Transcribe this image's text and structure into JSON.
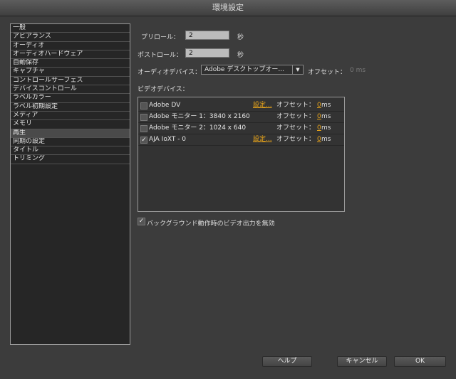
{
  "window": {
    "title": "環境設定"
  },
  "sidebar": {
    "items": [
      {
        "label": "一般"
      },
      {
        "label": "アピアランス"
      },
      {
        "label": "オーディオ"
      },
      {
        "label": "オーディオハードウェア"
      },
      {
        "label": "自動保存"
      },
      {
        "label": "キャプチャ"
      },
      {
        "label": "コントロールサーフェス"
      },
      {
        "label": "デバイスコントロール"
      },
      {
        "label": "ラベルカラー"
      },
      {
        "label": "ラベル初期設定"
      },
      {
        "label": "メディア"
      },
      {
        "label": "メモリ"
      },
      {
        "label": "再生"
      },
      {
        "label": "同期の設定"
      },
      {
        "label": "タイトル"
      },
      {
        "label": "トリミング"
      }
    ],
    "selected": "再生"
  },
  "playback": {
    "preroll_label": "プリロール：",
    "preroll_value": "2",
    "postroll_label": "ポストロール：",
    "postroll_value": "2",
    "seconds_unit": "秒",
    "audio_device_label": "オーディオデバイス：",
    "audio_device_value": "Adobe デスクトップオー...",
    "audio_offset_label": "オフセット：",
    "audio_offset_value": "0 ms",
    "video_device_label": "ビデオデバイス：",
    "devices": [
      {
        "name": "Adobe DV",
        "checked": "",
        "settings": "設定...",
        "offset_label": "オフセット：",
        "offset_value": "0",
        "unit": "ms"
      },
      {
        "name": "Adobe モニター 1：3840 x 2160",
        "checked": "",
        "settings": "",
        "offset_label": "オフセット：",
        "offset_value": "0",
        "unit": "ms"
      },
      {
        "name": "Adobe モニター 2：1024 x 640",
        "checked": "",
        "settings": "",
        "offset_label": "オフセット：",
        "offset_value": "0",
        "unit": "ms"
      },
      {
        "name": "AJA IoXT - 0",
        "checked": "✓",
        "settings": "設定...",
        "offset_label": "オフセット：",
        "offset_value": "0",
        "unit": "ms"
      }
    ],
    "disable_background_check": "✓",
    "disable_background_label": "バックグラウンド動作時のビデオ出力を無効"
  },
  "buttons": {
    "help": "ヘルプ",
    "cancel": "キャンセル",
    "ok": "OK"
  }
}
